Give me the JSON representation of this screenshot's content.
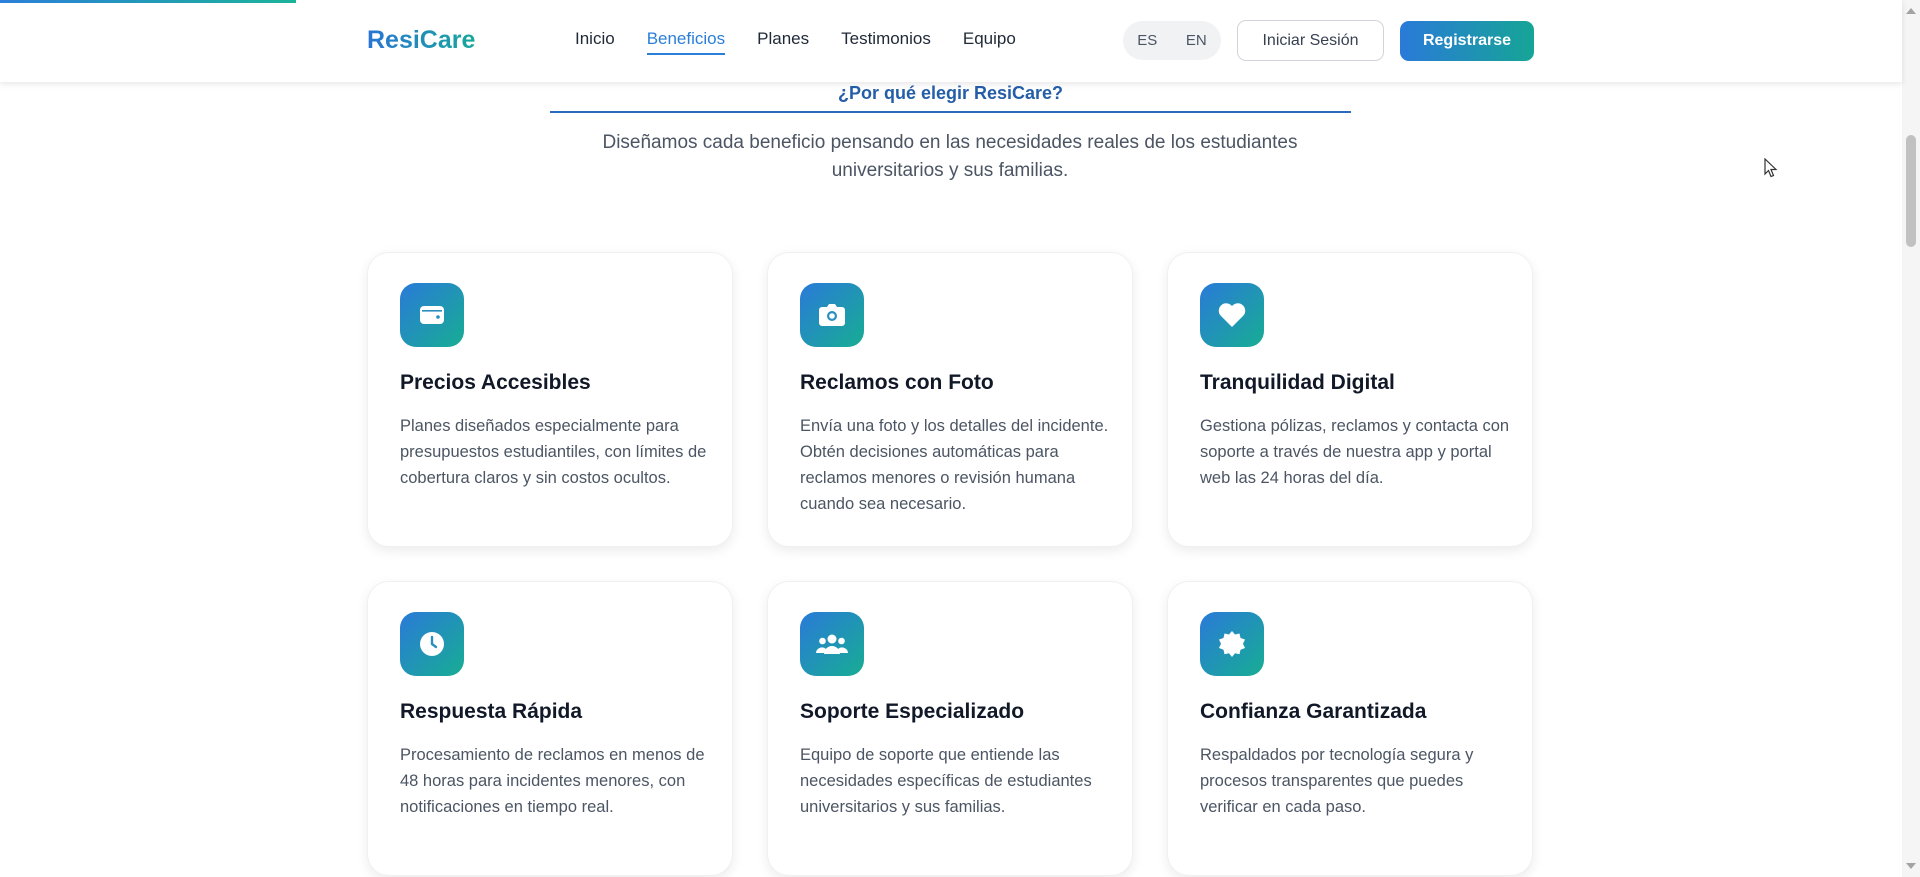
{
  "page": {
    "scroll_progress_percent": 15.4
  },
  "header": {
    "logo": "ResiCare",
    "nav": [
      "Inicio",
      "Beneficios",
      "Planes",
      "Testimonios",
      "Equipo"
    ],
    "active_nav": "Beneficios",
    "languages": [
      "ES",
      "EN"
    ],
    "login_label": "Iniciar Sesión",
    "register_label": "Registrarse"
  },
  "benefits": {
    "eyebrow": "¿Por qué elegir ResiCare?",
    "subtitle": "Diseñamos cada beneficio pensando en las necesidades reales de los estudiantes universitarios y sus familias.",
    "cards": [
      {
        "icon": "wallet-icon",
        "title": "Precios Accesibles",
        "text": "Planes diseñados especialmente para presupuestos estudiantiles, con límites de cobertura claros y sin costos ocultos."
      },
      {
        "icon": "camera-icon",
        "title": "Reclamos con Foto",
        "text": "Envía una foto y los detalles del incidente. Obtén decisiones automáticas para reclamos menores o revisión humana cuando sea necesario."
      },
      {
        "icon": "heart-icon",
        "title": "Tranquilidad Digital",
        "text": "Gestiona pólizas, reclamos y contacta con soporte a través de nuestra app y portal web las 24 horas del día."
      },
      {
        "icon": "clock-icon",
        "title": "Respuesta Rápida",
        "text": "Procesamiento de reclamos en menos de 48 horas para incidentes menores, con notificaciones en tiempo real."
      },
      {
        "icon": "users-icon",
        "title": "Soporte Especializado",
        "text": "Equipo de soporte que entiende las necesidades específicas de estudiantes universitarios y sus familias."
      },
      {
        "icon": "badge-icon",
        "title": "Confianza Garantizada",
        "text": "Respaldados por tecnología segura y procesos transparentes que puedes verificar en cada paso."
      }
    ]
  },
  "colors": {
    "primary": "#2b7fd8",
    "accent": "#17ad93",
    "heading": "#245ea8"
  }
}
